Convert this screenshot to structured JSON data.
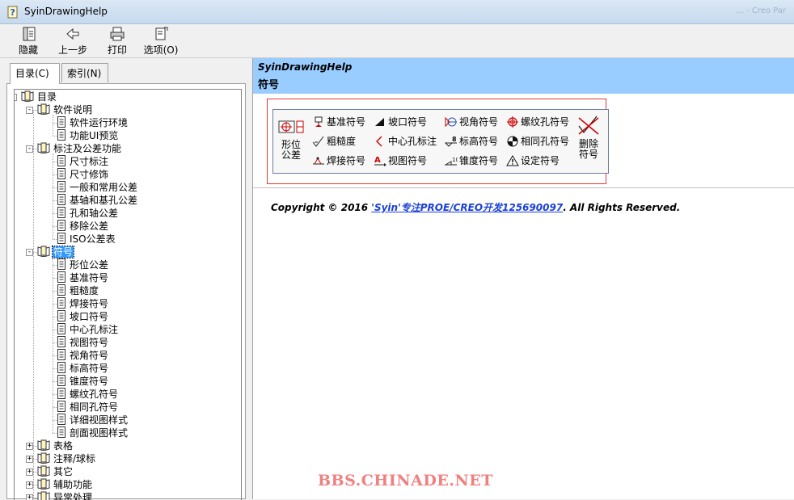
{
  "window": {
    "title": "SyinDrawingHelp",
    "ghost_title": "... - Creo Par"
  },
  "toolbar": {
    "hide_label": "隐藏",
    "back_label": "上一步",
    "print_label": "打印",
    "options_label": "选项(O)"
  },
  "tabs": {
    "contents_label": "目录(C)",
    "index_label": "索引(N)"
  },
  "tree": {
    "root": "目录",
    "n1": "软件说明",
    "n1_1": "软件运行环境",
    "n1_2": "功能UI预览",
    "n2": "标注及公差功能",
    "n2_1": "尺寸标注",
    "n2_2": "尺寸修饰",
    "n2_3": "一般和常用公差",
    "n2_4": "基轴和基孔公差",
    "n2_5": "孔和轴公差",
    "n2_6": "移除公差",
    "n2_7": "ISO公差表",
    "n3": "符号",
    "n3_1": "形位公差",
    "n3_2": "基准符号",
    "n3_3": "粗糙度",
    "n3_4": "焊接符号",
    "n3_5": "坡口符号",
    "n3_6": "中心孔标注",
    "n3_7": "视图符号",
    "n3_8": "视角符号",
    "n3_9": "标高符号",
    "n3_10": "锥度符号",
    "n3_11": "螺纹孔符号",
    "n3_12": "相同孔符号",
    "n3_13": "详细视图样式",
    "n3_14": "剖面视图样式",
    "n4": "表格",
    "n5": "注释/球标",
    "n6": "其它",
    "n7": "辅助功能",
    "n8": "异常处理"
  },
  "content": {
    "header_title": "SyinDrawingHelp",
    "header_subtitle": "符号",
    "symbols": {
      "gdt": "形位公差",
      "datum": "基准符号",
      "groove": "坡口符号",
      "view_angle": "视角符号",
      "thread_hole": "螺纹孔符号",
      "roughness": "粗糙度",
      "center_hole": "中心孔标注",
      "elevation": "标高符号",
      "same_hole": "相同孔符号",
      "weld": "焊接符号",
      "view": "视图符号",
      "taper": "锥度符号",
      "setting": "设定符号",
      "delete": "删除符号"
    },
    "copyright_prefix": "Copyright © 2016 ",
    "copyright_link": "'Syin'专注PROE/CREO开发125690097",
    "copyright_suffix": ". All Rights Reserved."
  },
  "watermark": "BBS.CHINADE.NET"
}
